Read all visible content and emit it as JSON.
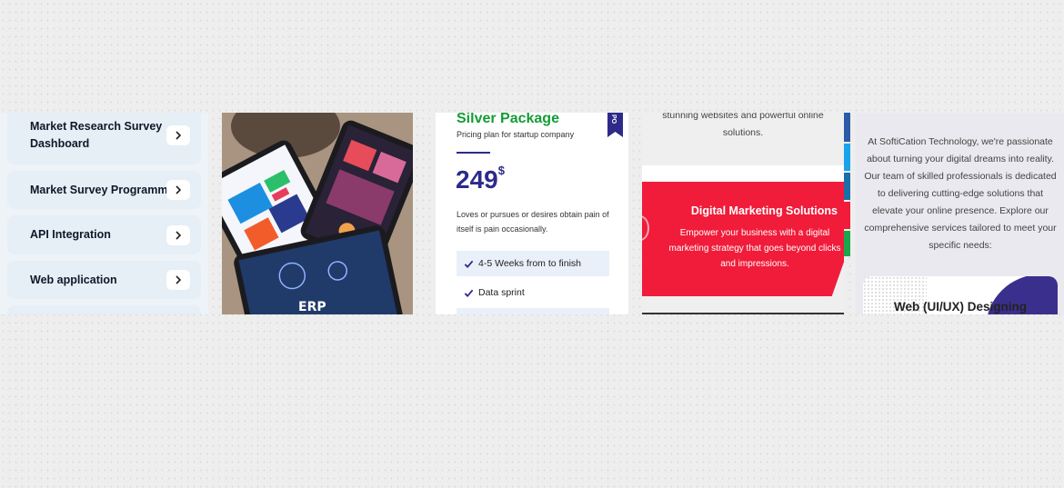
{
  "services": {
    "items": [
      {
        "label_line1": "Market Research Survey",
        "label_line2": "Dashboard"
      },
      {
        "label_line1": "Market Survey Programming",
        "label_line2": ""
      },
      {
        "label_line1": "API Integration",
        "label_line2": ""
      },
      {
        "label_line1": "Web application",
        "label_line2": ""
      }
    ],
    "chevron_icon": "chevron-right-icon"
  },
  "collage": {
    "icon": "tablets-collage-image",
    "erp_label": "ERP"
  },
  "pricing": {
    "title": "Silver Package",
    "subtitle": "Pricing plan for startup company",
    "price": "249",
    "currency": "$",
    "description": "Loves or pursues or desires obtain pain of itself is pain occasionally.",
    "ribbon_text": "PO",
    "features": [
      "4-5 Weeks from to finish",
      "Data sprint"
    ],
    "accent_color": "#139c34",
    "brand_color": "#2d2a8a"
  },
  "marketing": {
    "top_text": "stunning websites and powerful online solutions.",
    "title": "Digital Marketing Solutions",
    "text": "Empower your business with a digital marketing strategy that goes beyond clicks and impressions.",
    "accent_color": "#f01c3a"
  },
  "about": {
    "text": "At SoftiCation Technology, we're passionate about turning your digital dreams into reality. Our team of skilled professionals is dedicated to delivering cutting-edge solutions that elevate your online presence. Explore our comprehensive services tailored to meet your specific needs:",
    "card_title": "Web (UI/UX) Designing"
  }
}
